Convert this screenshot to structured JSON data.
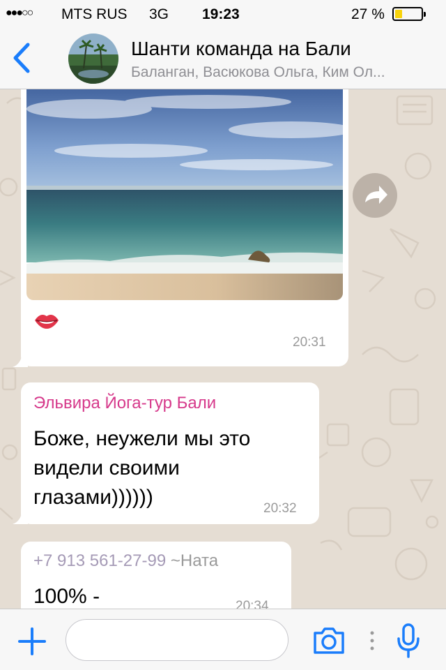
{
  "status_bar": {
    "signal": "●●●○○",
    "carrier": "MTS RUS",
    "network": "3G",
    "time": "19:23",
    "battery_percent": "27 %",
    "battery_level": 0.27
  },
  "header": {
    "back_icon": "chevron-left-icon",
    "title": "Шанти команда на Бали",
    "subtitle": "Баланган, Васюкова Ольга, Ким Ол..."
  },
  "messages": [
    {
      "type": "photo",
      "emoji": "lips-emoji",
      "time": "20:31"
    },
    {
      "type": "text",
      "sender": "Эльвира Йога-тур Бали",
      "lines": [
        "Боже,  неужели мы это",
        "видели своими",
        "глазами))))))"
      ],
      "time": "20:32"
    },
    {
      "type": "text",
      "sender_phone": "+7 913 561-27-99",
      "sender_alias": "~Ната",
      "lines": [
        "100% -"
      ],
      "time": "20:34"
    }
  ],
  "input_bar": {
    "placeholder": "",
    "icons": [
      "plus-icon",
      "camera-icon",
      "more-icon",
      "microphone-icon"
    ]
  },
  "colors": {
    "accent": "#1a7dfb",
    "sender_pink": "#d6398b",
    "sender_grey": "#a59ab6",
    "chat_bg": "#e5ddd3"
  }
}
